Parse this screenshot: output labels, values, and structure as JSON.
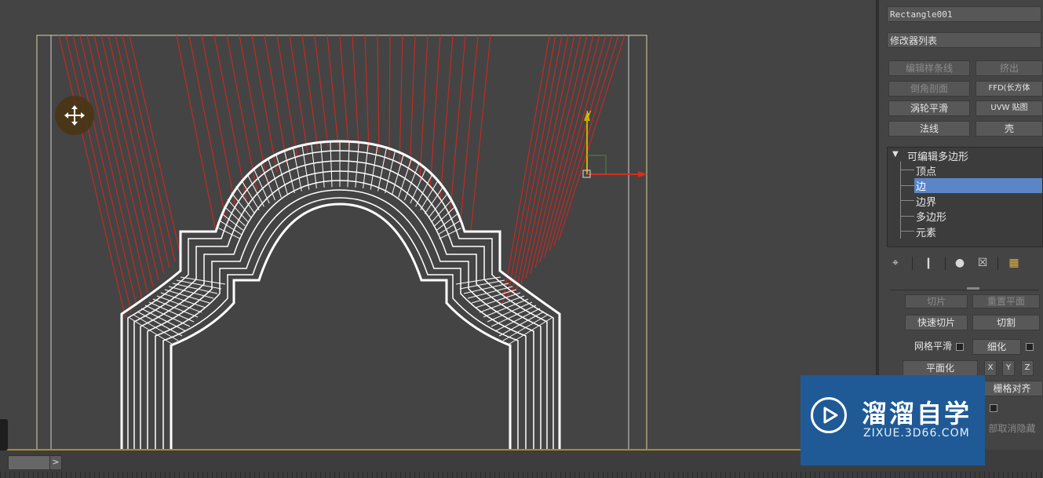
{
  "viewport": {
    "move_cursor": "move-icon",
    "gizmo": {
      "y_label": "y",
      "x_color": "#d03020",
      "y_color": "#c8b000"
    }
  },
  "panel": {
    "object_name": "Rectangle001",
    "modifier_list": "修改器列表",
    "modifier_buttons": [
      {
        "label": "编辑样条线",
        "enabled": false
      },
      {
        "label": "挤出",
        "enabled": false
      },
      {
        "label": "倒角剖面",
        "enabled": false
      },
      {
        "label": "FFD(长方体",
        "enabled": true
      },
      {
        "label": "涡轮平滑",
        "enabled": true
      },
      {
        "label": "UVW 贴图",
        "enabled": true
      },
      {
        "label": "法线",
        "enabled": true
      },
      {
        "label": "壳",
        "enabled": true
      }
    ],
    "stack": {
      "root": "可编辑多边形",
      "items": [
        "顶点",
        "边",
        "边界",
        "多边形",
        "元素"
      ],
      "selected": "边"
    },
    "toolbar_icons": [
      "pin-icon",
      "show-end-result-icon",
      "make-unique-icon",
      "remove-modifier-icon",
      "configure-icon"
    ],
    "edit_geometry": {
      "slice": "切片",
      "reset_plane": "重置平面",
      "quickslice": "快速切片",
      "cut": "切割",
      "meshsmooth": "网格平滑",
      "tessellate": "细化",
      "make_planar": "平面化",
      "x": "X",
      "y": "Y",
      "z": "Z",
      "grid_align": "栅格对齐",
      "unhide_all": "部取消隐藏"
    }
  },
  "watermark": {
    "title": "溜溜自学",
    "subtitle": "ZIXUE.3D66.COM"
  },
  "status": {
    "time_arrow": ">"
  },
  "colors": {
    "viewport_bg": "#444444",
    "wire": "#ffffff",
    "cut_lines": "#cc2222",
    "frame": "#d8d4a0",
    "selection_highlight": "#5a86c8",
    "watermark_bg": "#1f5a96"
  }
}
